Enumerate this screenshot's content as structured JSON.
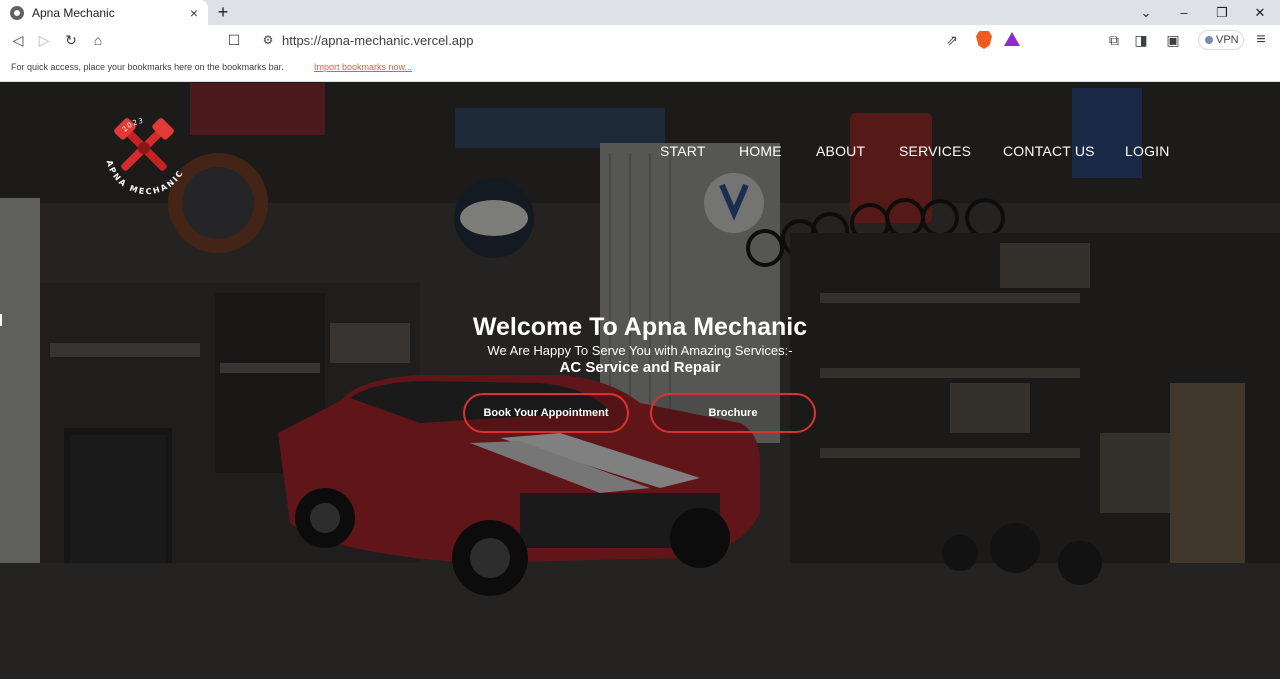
{
  "browser": {
    "tab_title": "Apna Mechanic",
    "tab_close": "×",
    "new_tab": "+",
    "url": "https://apna-mechanic.vercel.app",
    "vpn_label": "VPN",
    "bookmark_prompt": "For quick access, place your bookmarks here on the bookmarks bar.",
    "bookmark_import_link": "Import bookmarks now...",
    "win_controls": {
      "list": "⌄",
      "minimize": "–",
      "restore": "❐",
      "close": "✕"
    },
    "icons": {
      "back": "◁",
      "forward": "▷",
      "reload": "↻",
      "home": "⌂",
      "bookmark": "☐",
      "site_info": "⚙",
      "share": "⇗",
      "extensions": "⧉",
      "sidebar": "◨",
      "wallet": "▣",
      "menu": "≡"
    }
  },
  "site": {
    "logo": {
      "year": "2023",
      "brand": "APNA MECHANIC"
    },
    "nav": [
      "START",
      "HOME",
      "ABOUT",
      "SERVICES",
      "CONTACT US",
      "LOGIN"
    ],
    "hero": {
      "title": "Welcome To Apna Mechanic",
      "subtitle": "We Are Happy To Serve You with Amazing Services:-",
      "service": "AC Service and Repair",
      "buttons": {
        "book": "Book Your Appointment",
        "brochure": "Brochure"
      }
    }
  },
  "colors": {
    "accent": "#d9342b",
    "bookmark_link": "#e0603a",
    "car_red": "#c0282d"
  }
}
